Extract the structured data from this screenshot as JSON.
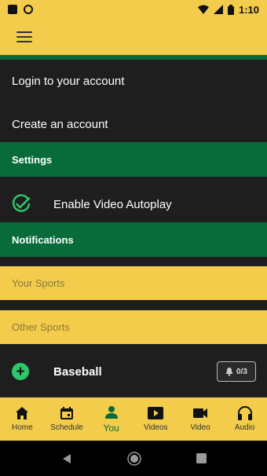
{
  "status_bar": {
    "time": "1:10"
  },
  "menu": {
    "login": "Login to your account",
    "create": "Create an account"
  },
  "settings": {
    "header": "Settings",
    "autoplay_label": "Enable Video Autoplay"
  },
  "notifications": {
    "header": "Notifications"
  },
  "your_sports": {
    "header": "Your Sports"
  },
  "other_sports": {
    "header": "Other Sports",
    "items": [
      {
        "label": "Baseball",
        "badge": "0/3",
        "icon": "plus-icon"
      }
    ]
  },
  "bottom_nav": {
    "items": [
      {
        "label": "Home",
        "icon": "home-icon"
      },
      {
        "label": "Schedule",
        "icon": "calendar-icon"
      },
      {
        "label": "You",
        "icon": "person-icon",
        "active": true
      },
      {
        "label": "Videos",
        "icon": "play-icon"
      },
      {
        "label": "Video",
        "icon": "videocam-icon"
      },
      {
        "label": "Audio",
        "icon": "headphones-icon"
      }
    ]
  },
  "colors": {
    "brand_yellow": "#f2cc4a",
    "brand_green": "#0a6b3a",
    "accent_green": "#2ec76a",
    "background": "#1e1e1e"
  }
}
